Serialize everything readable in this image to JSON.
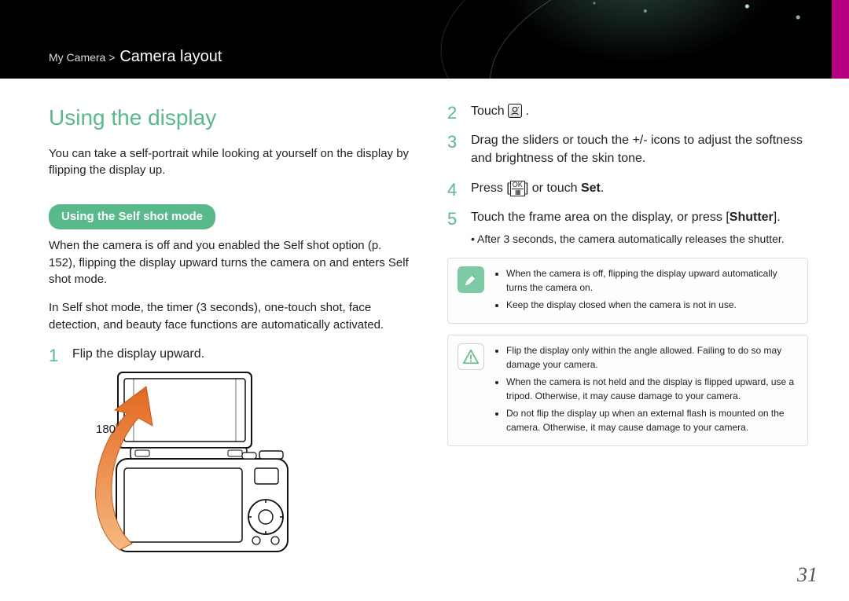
{
  "breadcrumb": {
    "section": "My Camera",
    "title": "Camera layout"
  },
  "left": {
    "h1": "Using the display",
    "intro": "You can take a self-portrait while looking at yourself on the display by flipping the display up.",
    "pill": "Using the Self shot mode",
    "p1": "When the camera is off and you enabled the Self shot option (p. 152), flipping the display upward turns the camera on and enters Self shot mode.",
    "p2": "In Self shot mode, the timer (3 seconds), one-touch shot, face detection, and beauty face functions are automatically activated.",
    "step1": "Flip the display upward.",
    "angle": "180˚"
  },
  "right": {
    "step2_pre": "Touch ",
    "step2_post": " .",
    "step3": "Drag the sliders or touch the +/- icons to adjust the softness and brightness of the skin tone.",
    "step4_pre": "Press [",
    "step4_mid": "] or touch ",
    "step4_set": "Set",
    "step4_post": ".",
    "step5_pre": "Touch the frame area on the display, or press [",
    "step5_shutter": "Shutter",
    "step5_post": "].",
    "step5_sub": "After 3 seconds, the camera automatically releases the shutter.",
    "tip": {
      "items": [
        "When the camera is off, flipping the display upward automatically turns the camera on.",
        "Keep the display closed when the camera is not in use."
      ]
    },
    "warn": {
      "items": [
        "Flip the display only within the angle allowed. Failing to do so may damage your camera.",
        "When the camera is not held and the display is flipped upward, use a tripod. Otherwise, it may cause damage to your camera.",
        "Do not flip the display up when an external flash is mounted on the camera. Otherwise, it may cause damage to your camera."
      ]
    }
  },
  "page": "31"
}
